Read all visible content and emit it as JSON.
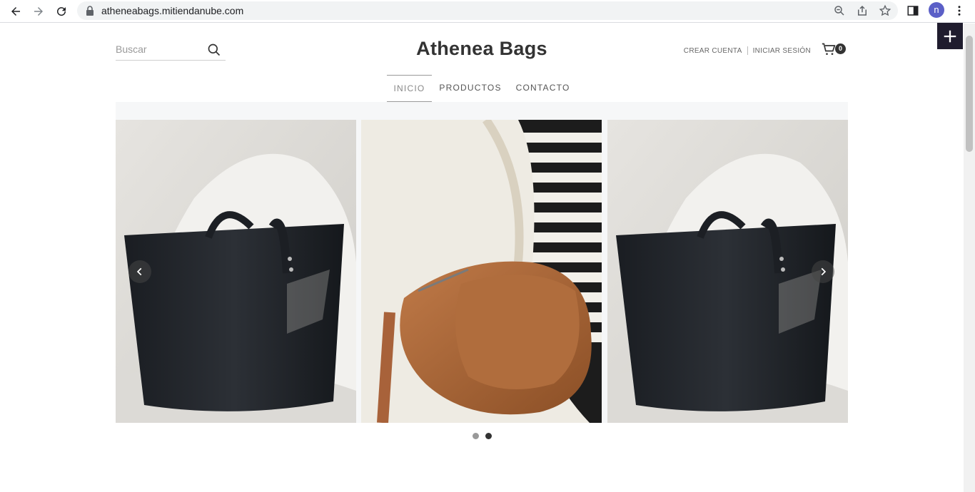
{
  "browser": {
    "url": "atheneabags.mitiendanube.com",
    "profile_initial": "n"
  },
  "header": {
    "search_placeholder": "Buscar",
    "brand": "Athenea Bags",
    "create_account": "CREAR CUENTA",
    "login": "INICIAR SESIÓN",
    "cart_count": "0"
  },
  "nav": {
    "items": [
      {
        "label": "INICIO"
      },
      {
        "label": "PRODUCTOS"
      },
      {
        "label": "CONTACTO"
      }
    ]
  },
  "carousel": {
    "slides": [
      {
        "icon": "black-tote-bag-image"
      },
      {
        "icon": "brown-crossbody-bag-image"
      },
      {
        "icon": "black-tote-bag-image"
      }
    ],
    "dots": 2,
    "active_dot": 2
  },
  "colors": {
    "brand_text": "#333333",
    "fab_bg": "#1f1c2e",
    "profile": "#5b5fc7"
  }
}
